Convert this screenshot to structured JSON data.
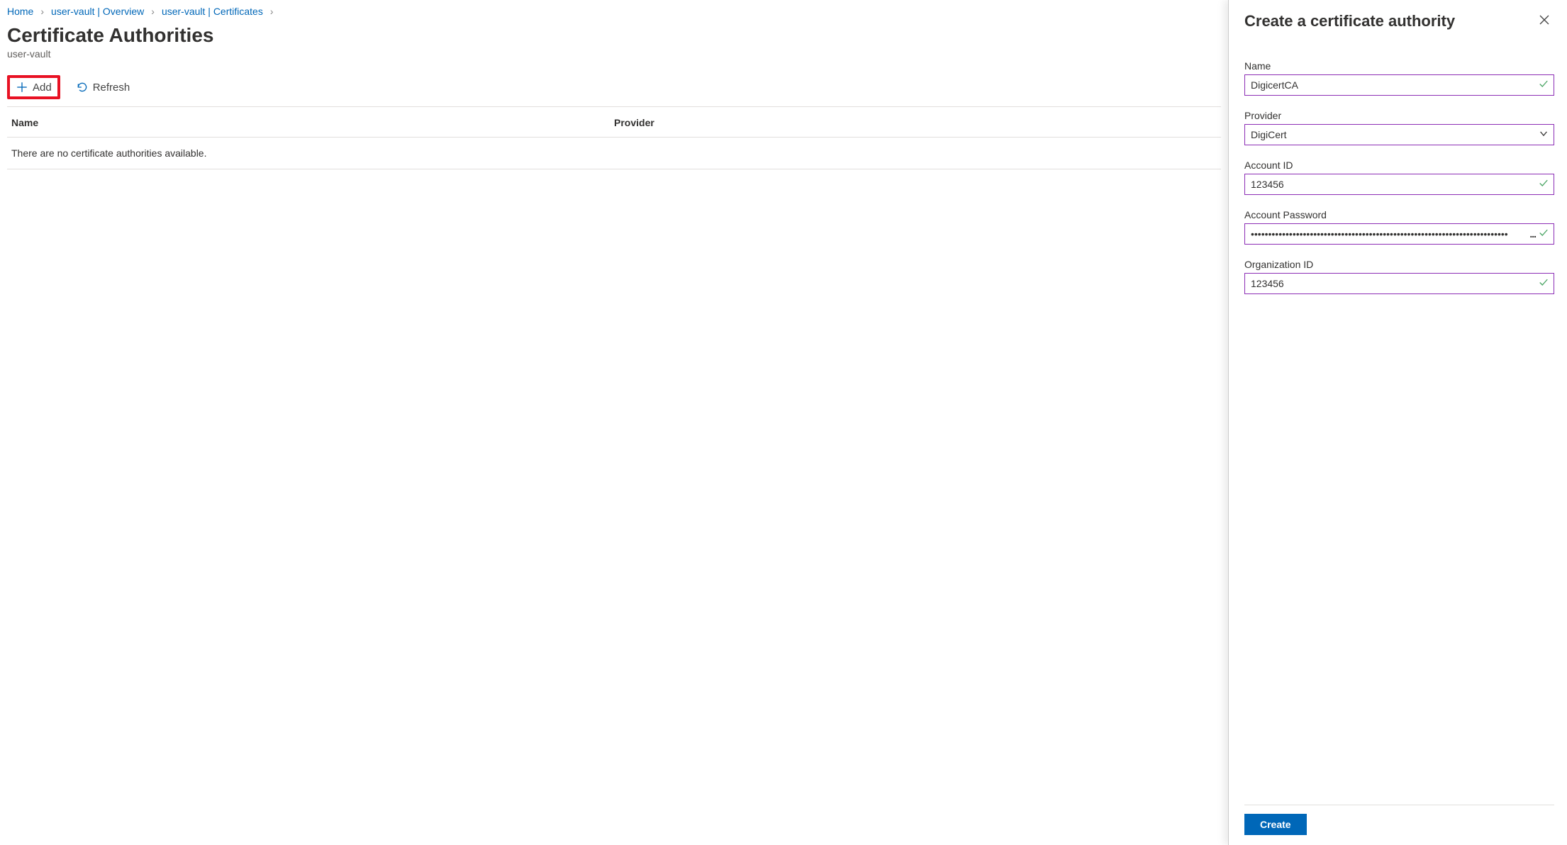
{
  "breadcrumb": {
    "items": [
      {
        "label": "Home"
      },
      {
        "label": "user-vault | Overview"
      },
      {
        "label": "user-vault | Certificates"
      }
    ]
  },
  "header": {
    "title": "Certificate Authorities",
    "subtitle": "user-vault"
  },
  "toolbar": {
    "add_label": "Add",
    "refresh_label": "Refresh"
  },
  "table": {
    "col_name": "Name",
    "col_provider": "Provider",
    "empty_message": "There are no certificate authorities available."
  },
  "panel": {
    "title": "Create a certificate authority",
    "name_label": "Name",
    "name_value": "DigicertCA",
    "provider_label": "Provider",
    "provider_value": "DigiCert",
    "account_id_label": "Account ID",
    "account_id_value": "123456",
    "account_password_label": "Account Password",
    "account_password_value": "••••••••••••••••••••••••••••••••••••••••••••••••••••••••••••••••••••••••••",
    "org_id_label": "Organization ID",
    "org_id_value": "123456",
    "create_label": "Create"
  }
}
